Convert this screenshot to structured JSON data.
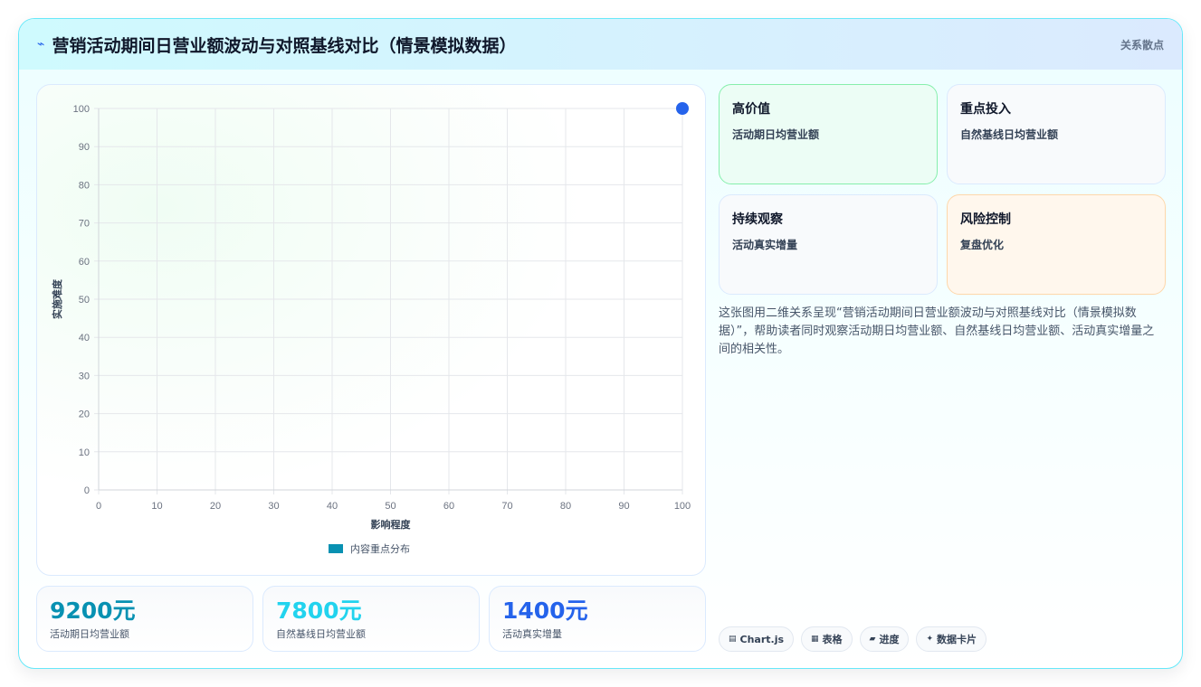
{
  "header": {
    "icon": "⌁",
    "title": "营销活动期间日营业额波动与对照基线对比（情景模拟数据）",
    "tag": "关系散点"
  },
  "chart_data": {
    "type": "scatter",
    "title": "",
    "xlabel": "影响程度",
    "ylabel": "实施难度",
    "xlim": [
      0,
      100
    ],
    "ylim": [
      0,
      100
    ],
    "x_ticks": [
      "0",
      "10",
      "20",
      "30",
      "40",
      "50",
      "60",
      "70",
      "80",
      "90",
      "100"
    ],
    "y_ticks": [
      "0",
      "10",
      "20",
      "30",
      "40",
      "50",
      "60",
      "70",
      "80",
      "90",
      "100"
    ],
    "grid": true,
    "legend_position": "bottom",
    "series": [
      {
        "name": "内容重点分布",
        "legend_color": "#0891b2",
        "point_color": "#2563eb",
        "points": [
          {
            "x": 100,
            "y": 100
          }
        ]
      }
    ]
  },
  "stats": [
    {
      "value": "9200元",
      "label": "活动期日均营业额",
      "color": "#0891b2"
    },
    {
      "value": "7800元",
      "label": "自然基线日均营业额",
      "color": "#22d3ee"
    },
    {
      "value": "1400元",
      "label": "活动真实增量",
      "color": "#2563eb"
    }
  ],
  "quadrants": [
    {
      "title": "高价值",
      "desc": "活动期日均营业额",
      "bg": "#ecfdf5",
      "border": "#86efac"
    },
    {
      "title": "重点投入",
      "desc": "自然基线日均营业额",
      "bg": "#f8fafc",
      "border": "#dbeafe"
    },
    {
      "title": "持续观察",
      "desc": "活动真实增量",
      "bg": "#f8fafc",
      "border": "#dbeafe"
    },
    {
      "title": "风险控制",
      "desc": "复盘优化",
      "bg": "#fff7ed",
      "border": "#fed7aa"
    }
  ],
  "description": "这张图用二维关系呈现“营销活动期间日营业额波动与对照基线对比（情景模拟数据）”，帮助读者同时观察活动期日均营业额、自然基线日均营业额、活动真实增量之间的相关性。",
  "pills": [
    {
      "icon": "▤",
      "label": "Chart.js"
    },
    {
      "icon": "▦",
      "label": "表格"
    },
    {
      "icon": "▰",
      "label": "进度"
    },
    {
      "icon": "✦",
      "label": "数据卡片"
    }
  ]
}
